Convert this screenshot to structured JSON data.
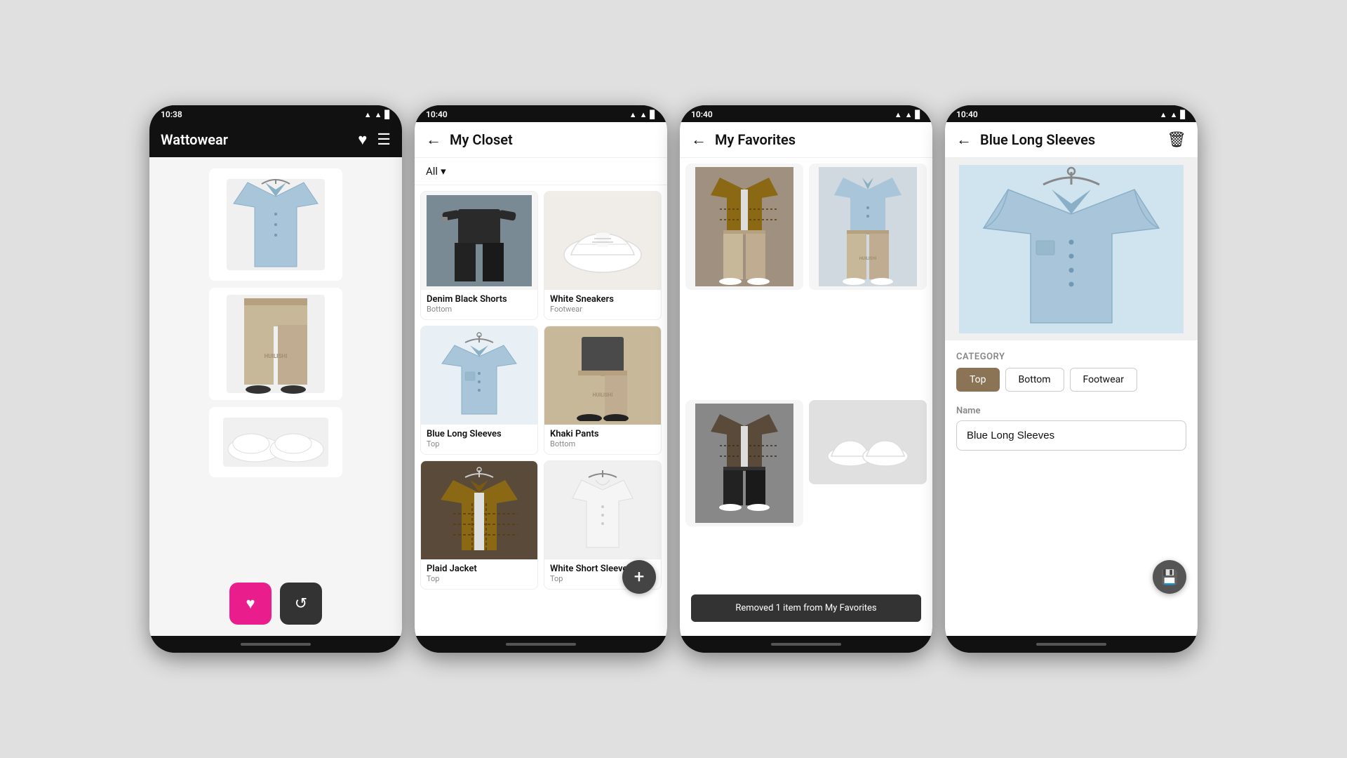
{
  "screens": [
    {
      "id": "home",
      "statusBar": {
        "time": "10:38",
        "icons": "▲▲▊"
      },
      "header": {
        "title": "Wattowear",
        "showHeart": true,
        "showMenu": true
      },
      "outfits": [
        {
          "type": "shirt",
          "label": "Blue Long Sleeves shirt"
        },
        {
          "type": "pants",
          "label": "Khaki Pants"
        },
        {
          "type": "shoes",
          "label": "White Sneakers"
        }
      ],
      "buttons": {
        "heart": "♥",
        "refresh": "↺"
      }
    },
    {
      "id": "closet",
      "statusBar": {
        "time": "10:40",
        "icons": "▲▲▊"
      },
      "header": {
        "title": "My Closet",
        "showBack": true
      },
      "filter": "All",
      "items": [
        {
          "name": "Denim Black Shorts",
          "category": "Bottom",
          "bg": "#6b7c8a"
        },
        {
          "name": "White Sneakers",
          "category": "Footwear",
          "bg": "#f0ede8"
        },
        {
          "name": "Blue Long Sleeves",
          "category": "Top",
          "bg": "#a8c5da"
        },
        {
          "name": "Khaki Pants",
          "category": "Bottom",
          "bg": "#c8b89a"
        },
        {
          "name": "Plaid Jacket",
          "category": "Top",
          "bg": "#5a4a3a"
        },
        {
          "name": "White Short Sleeves",
          "category": "Top",
          "bg": "#f5f5f5"
        }
      ],
      "fab": "+"
    },
    {
      "id": "favorites",
      "statusBar": {
        "time": "10:40",
        "icons": "▲▲▊"
      },
      "header": {
        "title": "My Favorites",
        "showBack": true
      },
      "items": [
        {
          "type": "outfit1",
          "bg": "#5a4a3a"
        },
        {
          "type": "outfit2",
          "bg": "#a8c5da"
        },
        {
          "type": "outfit3",
          "bg": "#5a4a3a"
        },
        {
          "type": "outfit4",
          "bg": "#6b6b6b"
        }
      ],
      "snackbar": "Removed 1 item from My Favorites"
    },
    {
      "id": "detail",
      "statusBar": {
        "time": "10:40",
        "icons": "▲▲▊"
      },
      "header": {
        "title": "Blue Long Sleeves",
        "showBack": true,
        "showDelete": true
      },
      "image": {
        "bg": "#d0e4f0"
      },
      "category": {
        "label": "Category",
        "chips": [
          {
            "label": "Top",
            "active": true
          },
          {
            "label": "Bottom",
            "active": false
          },
          {
            "label": "Footwear",
            "active": false
          }
        ]
      },
      "nameField": {
        "label": "Name",
        "value": "Blue Long Sleeves"
      }
    }
  ]
}
